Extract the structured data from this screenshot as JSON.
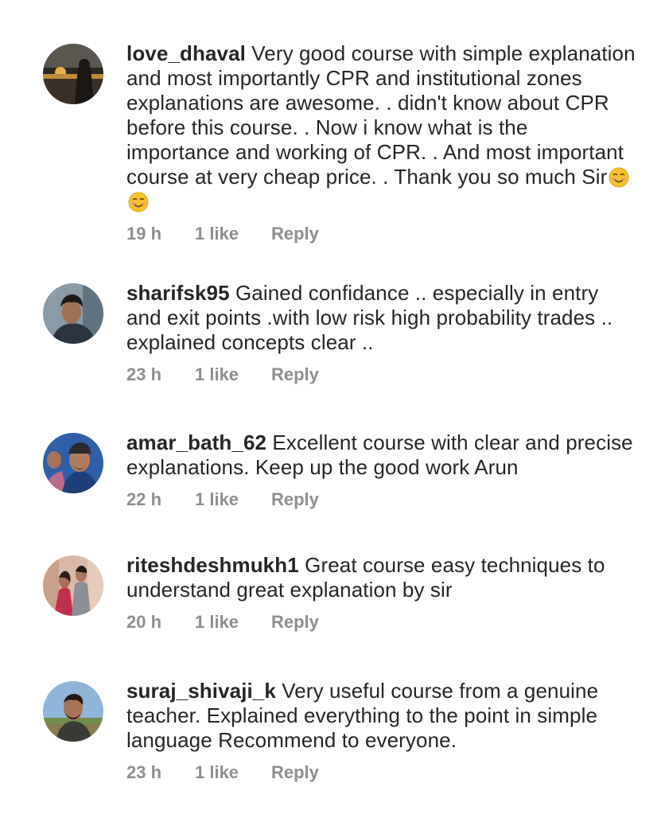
{
  "comments": [
    {
      "username": "love_dhaval",
      "text": "Very good course with simple explanation and most importantly CPR and institutional zones explanations are awesome. . didn't know about CPR before this course. . Now i know what is the importance and working of CPR. . And most important course at very cheap price. . Thank you so much Sir",
      "emojis": [
        "smiling-face-icon",
        "smiling-face-icon"
      ],
      "time": "19 h",
      "likes": "1 like",
      "reply": "Reply"
    },
    {
      "username": "sharifsk95",
      "text": "Gained confidance .. especially in entry and exit points .with low risk  high probability trades .. explained concepts clear ..",
      "time": "23 h",
      "likes": "1 like",
      "reply": "Reply"
    },
    {
      "username": "amar_bath_62",
      "text": "Excellent course with clear and precise explanations. Keep up the good work Arun",
      "time": "22 h",
      "likes": "1 like",
      "reply": "Reply"
    },
    {
      "username": "riteshdeshmukh1",
      "text": "Great course easy techniques to understand great explanation by sir",
      "time": "20 h",
      "likes": "1 like",
      "reply": "Reply"
    },
    {
      "username": "suraj_shivaji_k",
      "text": "Very useful course from a genuine teacher. Explained everything to the point in simple language  Recommend to everyone.",
      "time": "23 h",
      "likes": "1 like",
      "reply": "Reply"
    }
  ]
}
